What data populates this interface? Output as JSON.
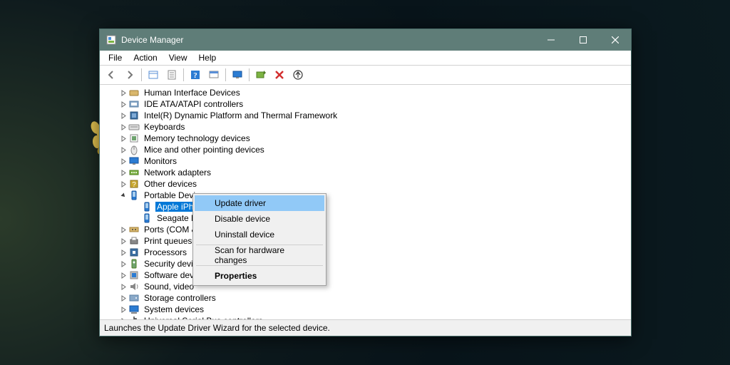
{
  "window": {
    "title": "Device Manager"
  },
  "menus": [
    "File",
    "Action",
    "View",
    "Help"
  ],
  "toolbar": {
    "buttons": [
      {
        "name": "back-icon"
      },
      {
        "name": "forward-icon"
      },
      {
        "sep": true
      },
      {
        "name": "show-hidden-icon"
      },
      {
        "name": "properties-page-icon"
      },
      {
        "sep": true
      },
      {
        "name": "help-icon"
      },
      {
        "name": "console-icon"
      },
      {
        "sep": true
      },
      {
        "name": "monitor-icon"
      },
      {
        "sep": true
      },
      {
        "name": "scan-hardware-icon"
      },
      {
        "name": "remove-device-icon"
      },
      {
        "name": "update-driver-icon"
      }
    ]
  },
  "tree": [
    {
      "depth": 1,
      "exp": "closed",
      "icon": "hid",
      "label": "Human Interface Devices"
    },
    {
      "depth": 1,
      "exp": "closed",
      "icon": "ide",
      "label": "IDE ATA/ATAPI controllers"
    },
    {
      "depth": 1,
      "exp": "closed",
      "icon": "chip",
      "label": "Intel(R) Dynamic Platform and Thermal Framework"
    },
    {
      "depth": 1,
      "exp": "closed",
      "icon": "keyboard",
      "label": "Keyboards"
    },
    {
      "depth": 1,
      "exp": "closed",
      "icon": "memory",
      "label": "Memory technology devices"
    },
    {
      "depth": 1,
      "exp": "closed",
      "icon": "mouse",
      "label": "Mice and other pointing devices"
    },
    {
      "depth": 1,
      "exp": "closed",
      "icon": "monitor",
      "label": "Monitors"
    },
    {
      "depth": 1,
      "exp": "closed",
      "icon": "net",
      "label": "Network adapters"
    },
    {
      "depth": 1,
      "exp": "closed",
      "icon": "other",
      "label": "Other devices"
    },
    {
      "depth": 1,
      "exp": "open",
      "icon": "portable",
      "label": "Portable Devices"
    },
    {
      "depth": 2,
      "exp": "none",
      "icon": "phone",
      "label": "Apple iPhone",
      "selected": true
    },
    {
      "depth": 2,
      "exp": "none",
      "icon": "phone",
      "label": "Seagate E",
      "cut": true
    },
    {
      "depth": 1,
      "exp": "closed",
      "icon": "ports",
      "label": "Ports (COM &",
      "cut": true
    },
    {
      "depth": 1,
      "exp": "closed",
      "icon": "printer",
      "label": "Print queues"
    },
    {
      "depth": 1,
      "exp": "closed",
      "icon": "cpu",
      "label": "Processors"
    },
    {
      "depth": 1,
      "exp": "closed",
      "icon": "security",
      "label": "Security devic",
      "cut": true
    },
    {
      "depth": 1,
      "exp": "closed",
      "icon": "software",
      "label": "Software devi",
      "cut": true
    },
    {
      "depth": 1,
      "exp": "closed",
      "icon": "sound",
      "label": "Sound, video",
      "cut": true
    },
    {
      "depth": 1,
      "exp": "closed",
      "icon": "storage",
      "label": "Storage controllers"
    },
    {
      "depth": 1,
      "exp": "closed",
      "icon": "system",
      "label": "System devices"
    },
    {
      "depth": 1,
      "exp": "closed",
      "icon": "usb",
      "label": "Universal Serial Bus controllers"
    }
  ],
  "context_menu": {
    "items": [
      {
        "label": "Update driver",
        "hover": true
      },
      {
        "label": "Disable device"
      },
      {
        "label": "Uninstall device"
      },
      {
        "sep": true
      },
      {
        "label": "Scan for hardware changes"
      },
      {
        "sep": true
      },
      {
        "label": "Properties",
        "bold": true
      }
    ]
  },
  "statusbar": {
    "text": "Launches the Update Driver Wizard for the selected device."
  },
  "colors": {
    "titlebar": "#5f7d78",
    "selection": "#0078d7",
    "menu_hover": "#91c9f7"
  }
}
